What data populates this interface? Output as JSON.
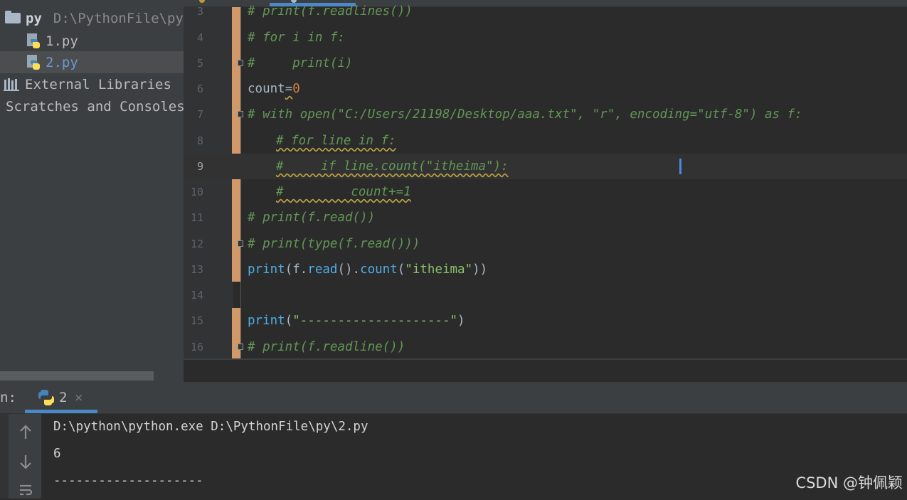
{
  "project_tree": {
    "root_name": "py",
    "root_path": "D:\\PythonFile\\py",
    "files": [
      "1.py",
      "2.py"
    ],
    "external_libraries": "External Libraries",
    "scratches": "Scratches and Consoles"
  },
  "editor": {
    "lines": [
      {
        "no": "3",
        "text": "# print(f.readlines())"
      },
      {
        "no": "4",
        "text": "# for i in f:"
      },
      {
        "no": "5",
        "text": "#     print(i)"
      },
      {
        "no": "6",
        "name": "count",
        "op": "=",
        "value": "0"
      },
      {
        "no": "7",
        "text": "# with open(\"C:/Users/21198/Desktop/aaa.txt\", \"r\", encoding=\"utf-8\") as f:"
      },
      {
        "no": "8",
        "text": "# for line in f:"
      },
      {
        "no": "9",
        "text": "#     if line.count(\"itheima\"):"
      },
      {
        "no": "10",
        "text": "#         count+=1"
      },
      {
        "no": "11",
        "text": "# print(f.read())"
      },
      {
        "no": "12",
        "text": "# print(type(f.read()))"
      },
      {
        "no": "13",
        "fn": "print",
        "p1": "(f.",
        "m1": "read",
        "p2": "().",
        "m2": "count",
        "p3": "(",
        "s": "\"itheima\"",
        "p4": "))"
      },
      {
        "no": "14"
      },
      {
        "no": "15",
        "fn": "print",
        "p1": "(",
        "s": "\"--------------------\"",
        "p4": ")"
      },
      {
        "no": "16",
        "text": "# print(f.readline())"
      }
    ]
  },
  "run_panel": {
    "label": "n:",
    "tab_label": "2",
    "tab_close": "×",
    "output": [
      "D:\\python\\python.exe D:\\PythonFile\\py\\2.py",
      "6",
      "--------------------"
    ]
  },
  "watermark": "CSDN @钟佩颖",
  "colors": {
    "background": "#2b2b2b",
    "panel": "#3c3f41",
    "comment": "#629755",
    "keyword": "#4eade5",
    "string": "#8bc06d",
    "number": "#d67d3f",
    "change_bar": "#d1986a",
    "accent": "#4a88c7"
  }
}
